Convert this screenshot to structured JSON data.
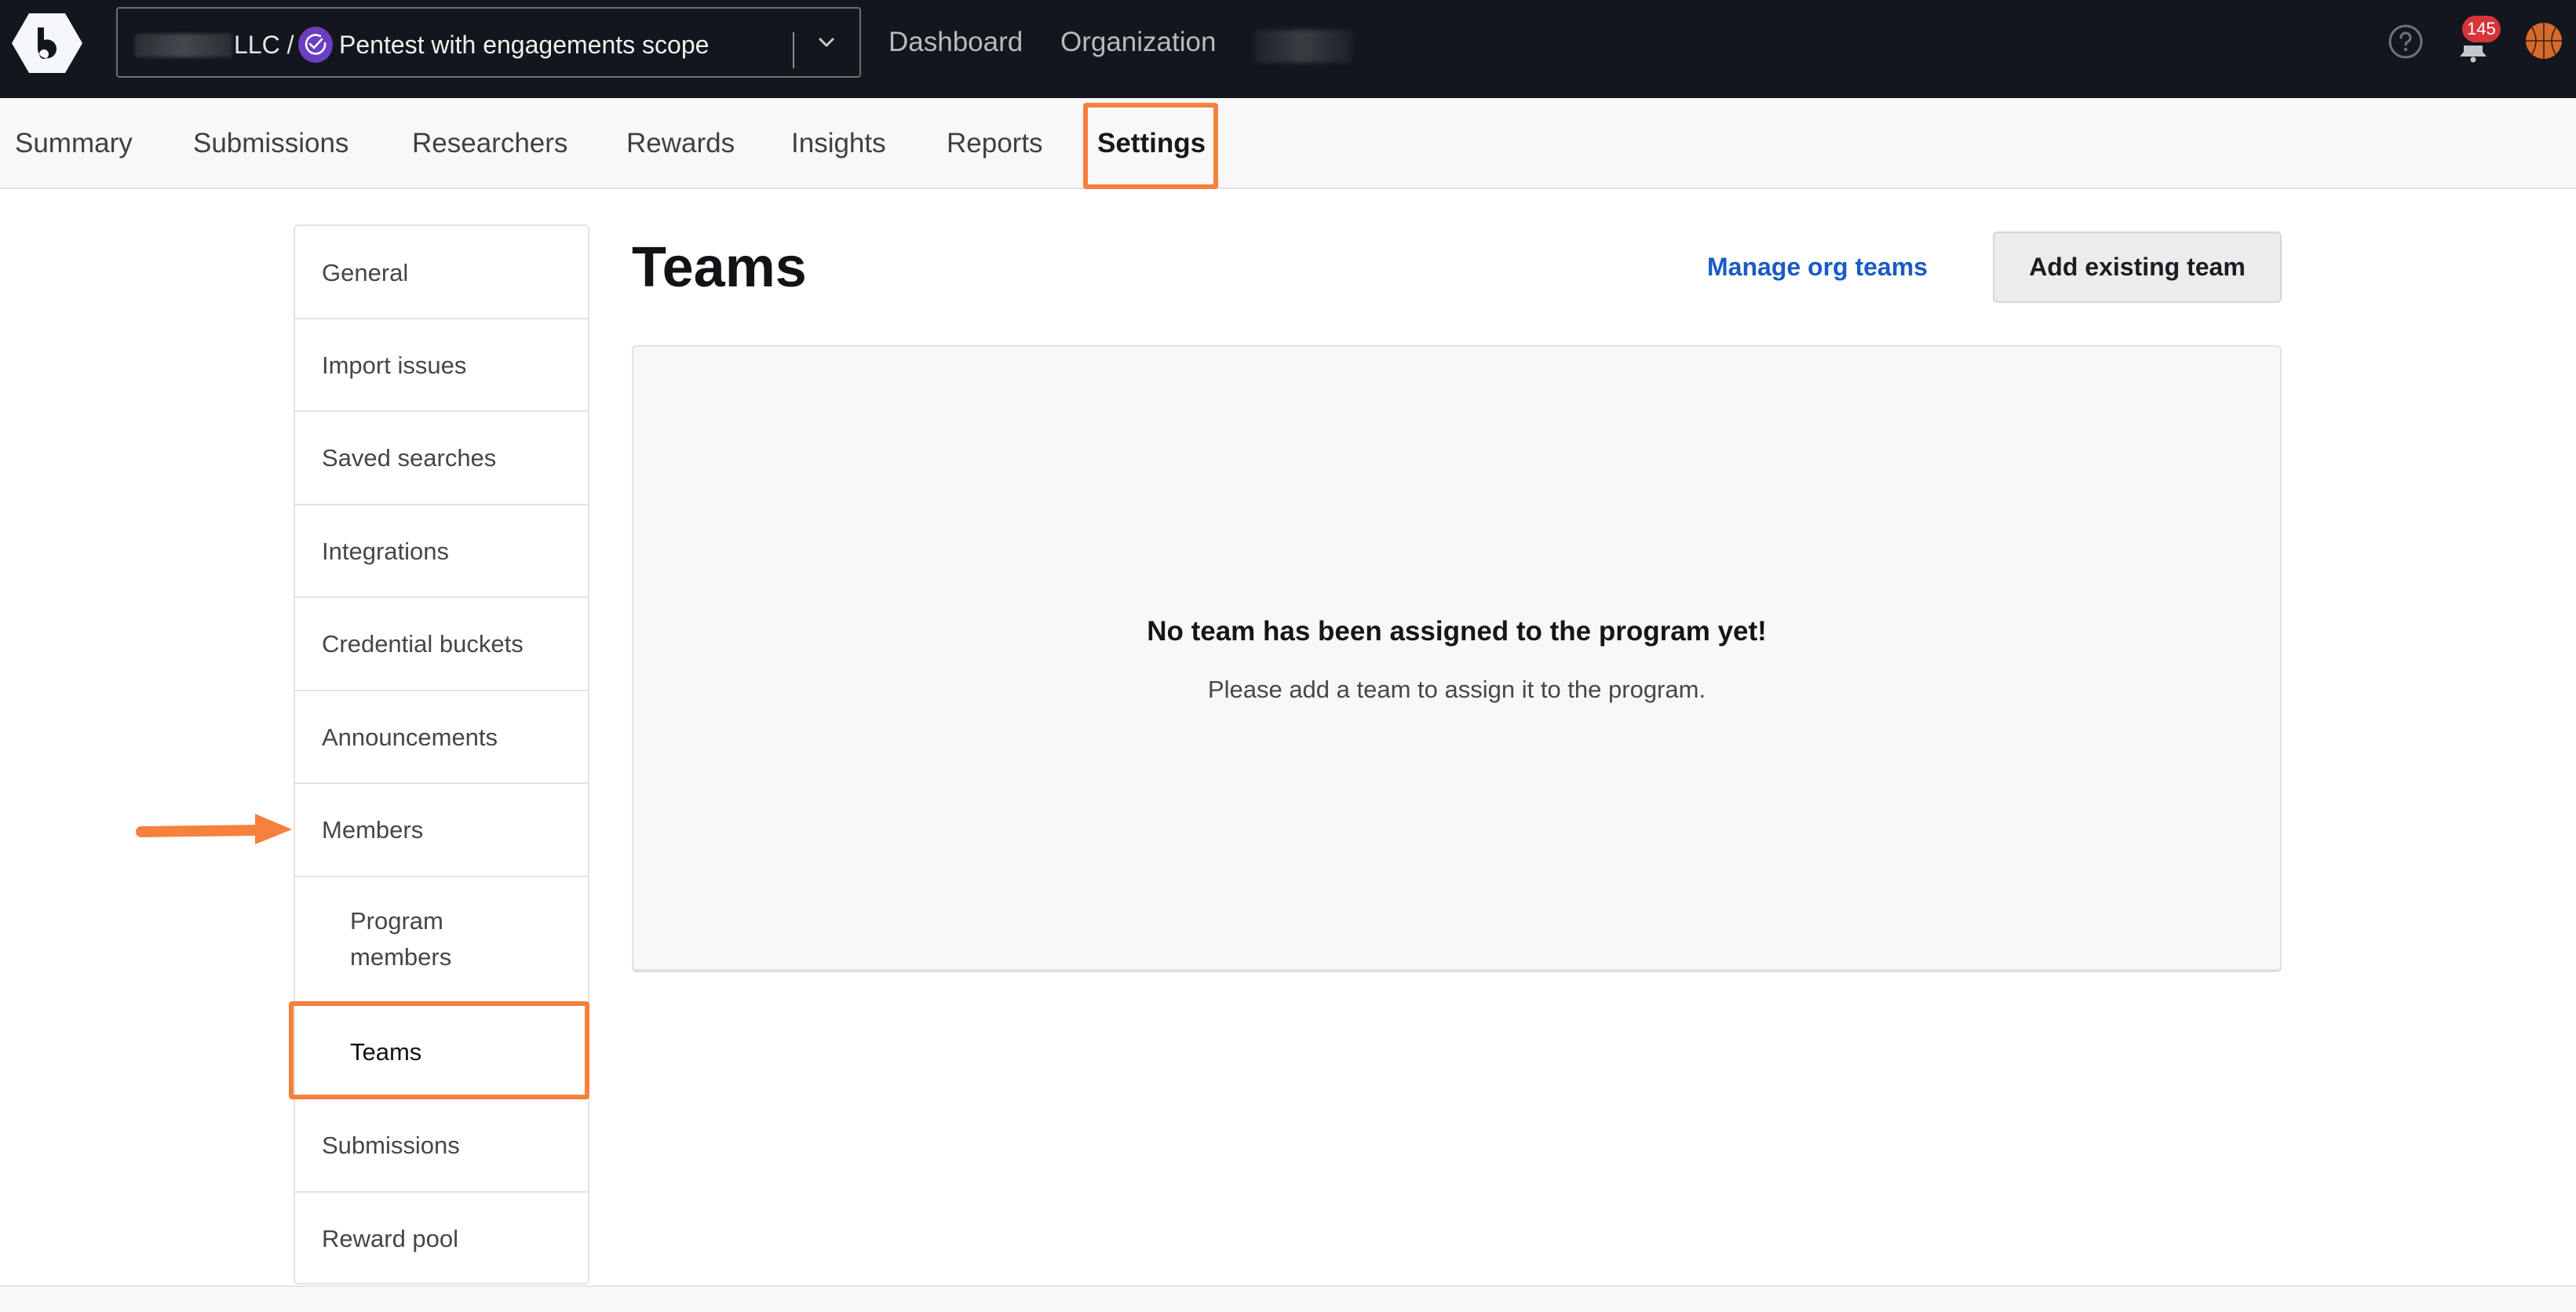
{
  "topbar": {
    "logo_icon": "bugcrowd-hexagon-logo",
    "program_selector": {
      "org_suffix": "LLC /",
      "program_icon": "check-badge-icon",
      "program_name": "Pentest with engagements scope",
      "chevron_icon": "chevron-down-icon"
    },
    "links": [
      {
        "label": "Dashboard"
      },
      {
        "label": "Organization"
      }
    ],
    "help_icon": "question-circle-icon",
    "notifications": {
      "icon": "bell-icon",
      "count": "145"
    },
    "avatar_icon": "basketball-avatar"
  },
  "nav": {
    "tabs": [
      {
        "label": "Summary"
      },
      {
        "label": "Submissions"
      },
      {
        "label": "Researchers"
      },
      {
        "label": "Rewards"
      },
      {
        "label": "Insights"
      },
      {
        "label": "Reports"
      },
      {
        "label": "Settings",
        "active": true
      }
    ]
  },
  "sidebar": {
    "items": [
      {
        "label": "General"
      },
      {
        "label": "Import issues"
      },
      {
        "label": "Saved searches"
      },
      {
        "label": "Integrations"
      },
      {
        "label": "Credential buckets"
      },
      {
        "label": "Announcements"
      },
      {
        "label": "Members"
      },
      {
        "label": "Program members",
        "sub": true
      },
      {
        "label": "Teams",
        "sub": true,
        "active": true
      },
      {
        "label": "Submissions"
      },
      {
        "label": "Reward pool"
      }
    ]
  },
  "main": {
    "title": "Teams",
    "manage_link": "Manage org teams",
    "add_button": "Add existing team",
    "empty_state": {
      "title": "No team has been assigned to the program yet!",
      "text": "Please add a team to assign it to the program."
    }
  },
  "colors": {
    "topbar_bg": "#13161d",
    "accent_link": "#1a5bc4",
    "annotation_orange": "#f5813d",
    "badge_red": "#d6343a",
    "program_badge_purple": "#6a3fc1"
  }
}
